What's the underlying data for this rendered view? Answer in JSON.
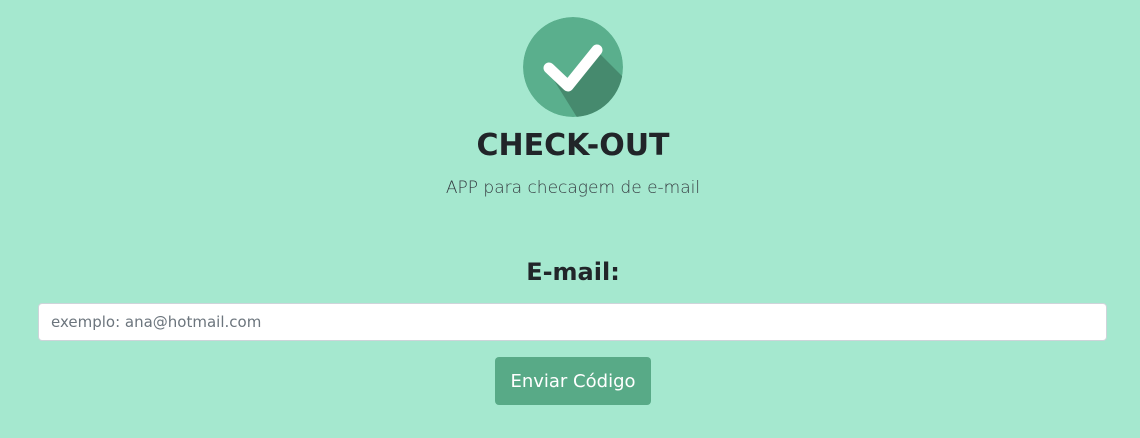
{
  "header": {
    "logo_icon": "check-circle-icon",
    "title": "CHECK-OUT",
    "subtitle": "APP para checagem de e-mail"
  },
  "form": {
    "email_label": "E-mail:",
    "email_value": "",
    "email_placeholder": "exemplo: ana@hotmail.com",
    "submit_label": "Enviar Código"
  },
  "colors": {
    "background": "#a5e8cf",
    "logo_circle": "#5aaf8d",
    "logo_shadow": "#468a6e",
    "button": "#58aa87",
    "input_background": "#ffffff"
  }
}
